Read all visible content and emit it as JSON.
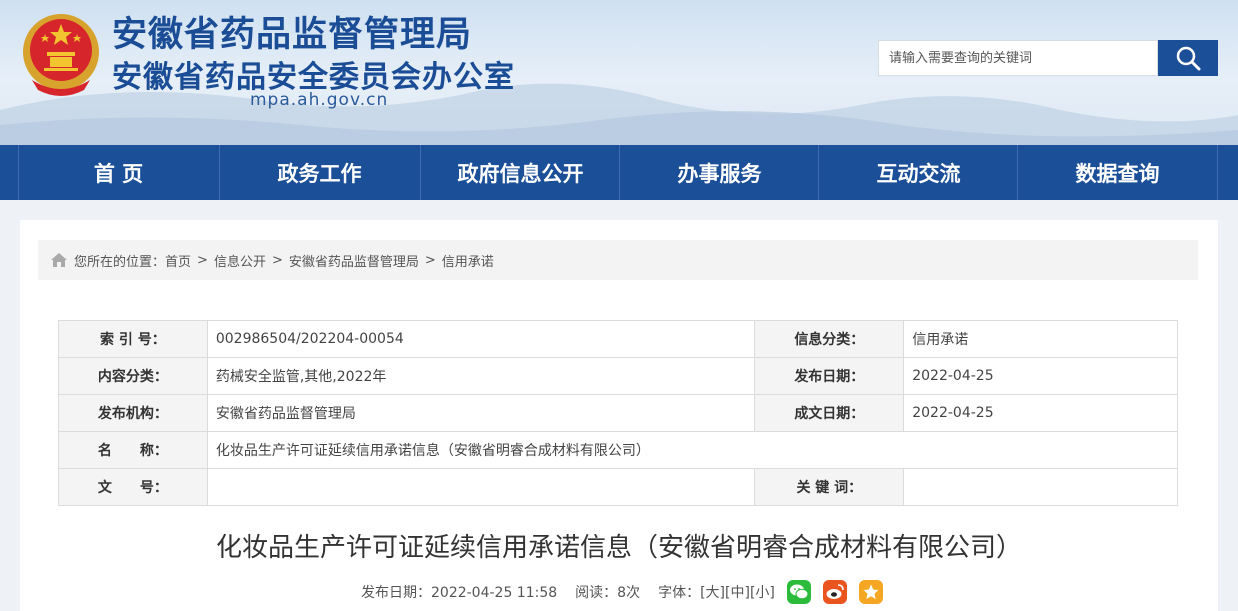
{
  "header": {
    "title": "安徽省药品监督管理局",
    "subtitle": "安徽省药品安全委员会办公室",
    "domain": "mpa.ah.gov.cn",
    "search_placeholder": "请输入需要查询的关键词"
  },
  "nav": {
    "items": [
      "首 页",
      "政务工作",
      "政府信息公开",
      "办事服务",
      "互动交流",
      "数据查询"
    ]
  },
  "breadcrumb": {
    "prefix": "您所在的位置：",
    "items": [
      "首页",
      "信息公开",
      "安徽省药品监督管理局",
      "信用承诺"
    ],
    "separator": ">"
  },
  "meta": {
    "index_label": "索 引 号：",
    "index_value": "002986504/202204-00054",
    "category_label": "信息分类：",
    "category_value": "信用承诺",
    "content_label": "内容分类：",
    "content_value": "药械安全监管,其他,2022年",
    "publish_date_label": "发布日期：",
    "publish_date_value": "2022-04-25",
    "org_label": "发布机构：",
    "org_value": "安徽省药品监督管理局",
    "doc_date_label": "成文日期：",
    "doc_date_value": "2022-04-25",
    "name_label": "名　　称：",
    "name_value": "化妆品生产许可证延续信用承诺信息（安徽省明睿合成材料有限公司）",
    "docno_label": "文　　号：",
    "docno_value": "",
    "keywords_label": "关 键 词：",
    "keywords_value": ""
  },
  "article": {
    "title": "化妆品生产许可证延续信用承诺信息（安徽省明睿合成材料有限公司）",
    "date_text": "发布日期：2022-04-25 11:58",
    "views_text": "阅读：8次",
    "font_label": "字体：",
    "font_large": "[大]",
    "font_medium": "[中]",
    "font_small": "[小]"
  },
  "share_icons": [
    "wechat-icon",
    "weibo-icon",
    "favorite-star-icon"
  ],
  "colors": {
    "brand_blue": "#1b4f98",
    "wechat_green": "#2dbb3c",
    "weibo_orange": "#e9541f",
    "star_orange": "#f5a623"
  }
}
